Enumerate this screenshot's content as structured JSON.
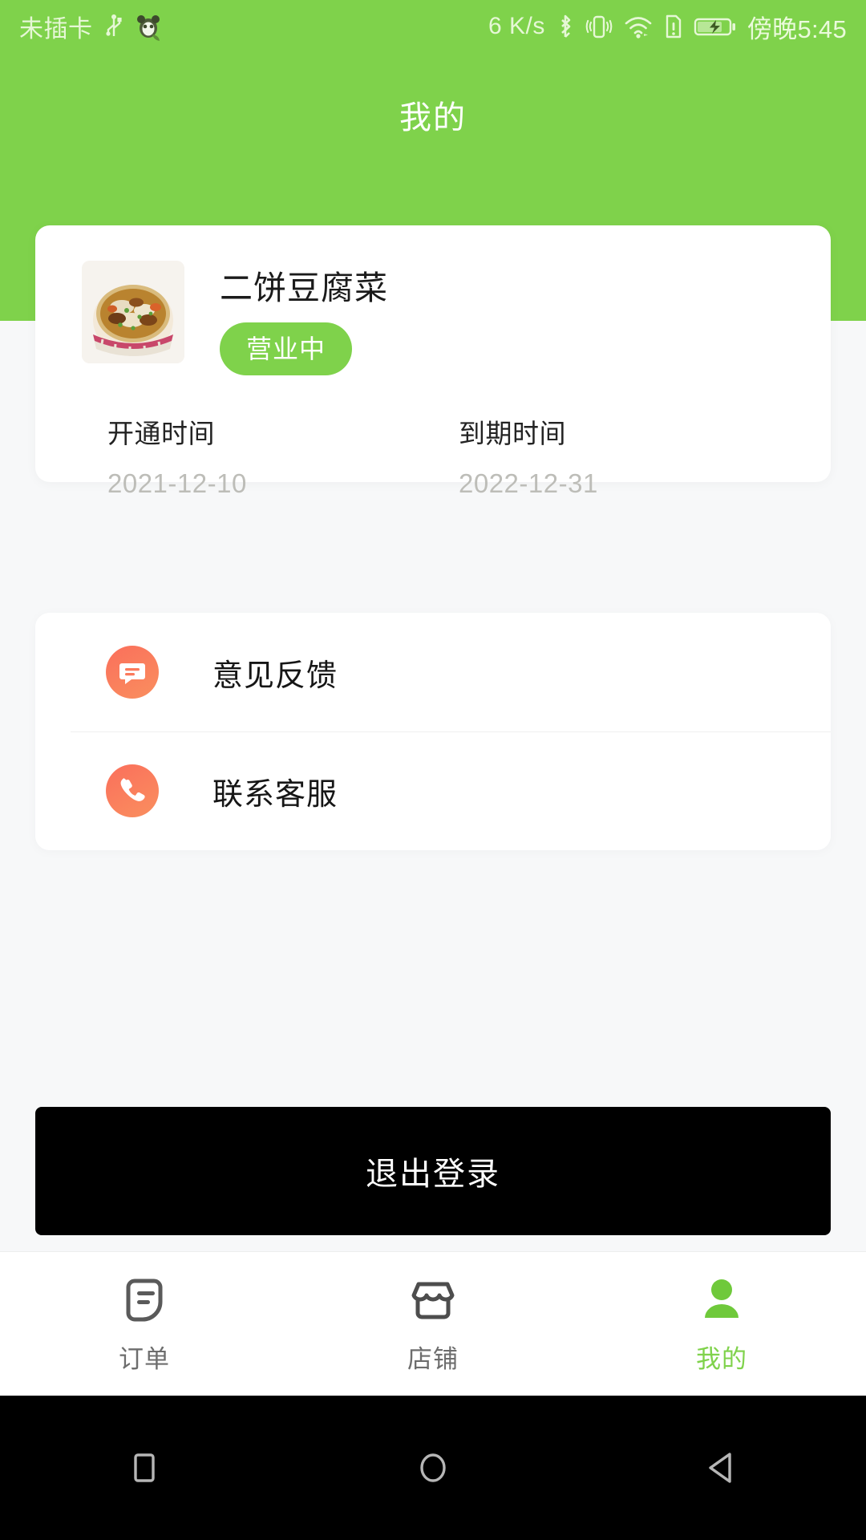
{
  "statusbar": {
    "carrier": "未插卡",
    "usb_icon": "usb-icon",
    "app_icon": "panda-app-icon",
    "network_speed": "6 K/s",
    "bluetooth_icon": "bluetooth-icon",
    "vibrate_icon": "vibrate-icon",
    "wifi_icon": "wifi-icon",
    "sim_alert_icon": "sim-alert-icon",
    "battery_icon": "battery-charging-icon",
    "time": "傍晚5:45"
  },
  "header": {
    "title": "我的",
    "background_color": "#7fd24b"
  },
  "shop_card": {
    "avatar_icon": "noodle-bowl-photo",
    "name": "二饼豆腐菜",
    "status_badge": "营业中",
    "status_badge_color": "#7fd24b",
    "dates": [
      {
        "label": "开通时间",
        "value": "2021-12-10"
      },
      {
        "label": "到期时间",
        "value": "2022-12-31"
      }
    ]
  },
  "menu": {
    "items": [
      {
        "icon": "chat-bubble-icon",
        "label": "意见反馈",
        "icon_color": "#fb7a5c"
      },
      {
        "icon": "phone-icon",
        "label": "联系客服",
        "icon_color": "#fb7a5c"
      }
    ]
  },
  "logout": {
    "label": "退出登录",
    "background_color": "#000000"
  },
  "tabbar": {
    "active_color": "#7fd24b",
    "inactive_color": "#6d6d6d",
    "items": [
      {
        "icon": "order-document-icon",
        "label": "订单",
        "active": false
      },
      {
        "icon": "storefront-icon",
        "label": "店铺",
        "active": false
      },
      {
        "icon": "person-icon",
        "label": "我的",
        "active": true
      }
    ]
  },
  "system_nav": {
    "buttons": [
      {
        "icon": "square-recents-icon"
      },
      {
        "icon": "circle-home-icon"
      },
      {
        "icon": "triangle-back-icon"
      }
    ]
  }
}
